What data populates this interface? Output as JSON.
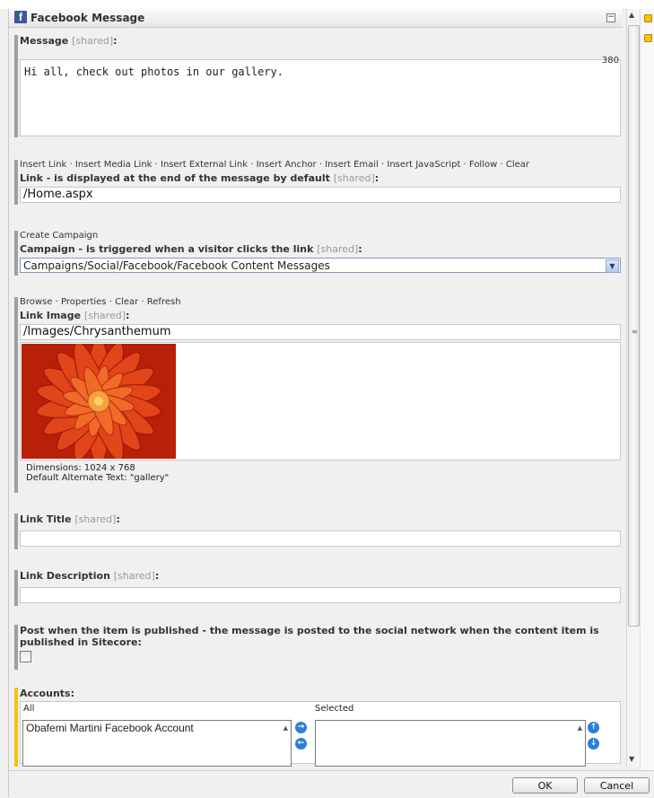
{
  "header": {
    "title": "Facebook Message",
    "icon": "facebook-icon"
  },
  "message": {
    "label": "Message",
    "shared": "[shared]",
    "counter": "380",
    "value": "Hi all, check out photos in our gallery."
  },
  "link": {
    "commands": [
      "Insert Link",
      "Insert Media Link",
      "Insert External Link",
      "Insert Anchor",
      "Insert Email",
      "Insert JavaScript",
      "Follow",
      "Clear"
    ],
    "label": "Link - is displayed at the end of the message by default",
    "shared": "[shared]",
    "value": "/Home.aspx"
  },
  "campaign": {
    "command": "Create Campaign",
    "label": "Campaign - is triggered when a visitor clicks the link",
    "shared": "[shared]",
    "value": "Campaigns/Social/Facebook/Facebook Content Messages"
  },
  "link_image": {
    "commands": [
      "Browse",
      "Properties",
      "Clear",
      "Refresh"
    ],
    "label": "Link Image",
    "shared": "[shared]",
    "value": "/Images/Chrysanthemum",
    "dimensions": "Dimensions: 1024 x 768",
    "alt_text": "Default Alternate Text: \"gallery\""
  },
  "link_title": {
    "label": "Link Title",
    "shared": "[shared]",
    "value": ""
  },
  "link_description": {
    "label": "Link Description",
    "shared": "[shared]",
    "value": ""
  },
  "post_when_published": {
    "label": "Post when the item is published - the message is posted to the social network when the content item is published in Sitecore:",
    "checked": false
  },
  "accounts": {
    "label": "Accounts:",
    "all_label": "All",
    "selected_label": "Selected",
    "all_items": [
      "Obafemi Martini Facebook Account"
    ],
    "selected_items": []
  },
  "footer": {
    "ok_label": "OK",
    "cancel_label": "Cancel"
  },
  "colors": {
    "facebook": "#3b5998",
    "accent": "#f1c40f",
    "circle_button": "#2b7fd8"
  }
}
